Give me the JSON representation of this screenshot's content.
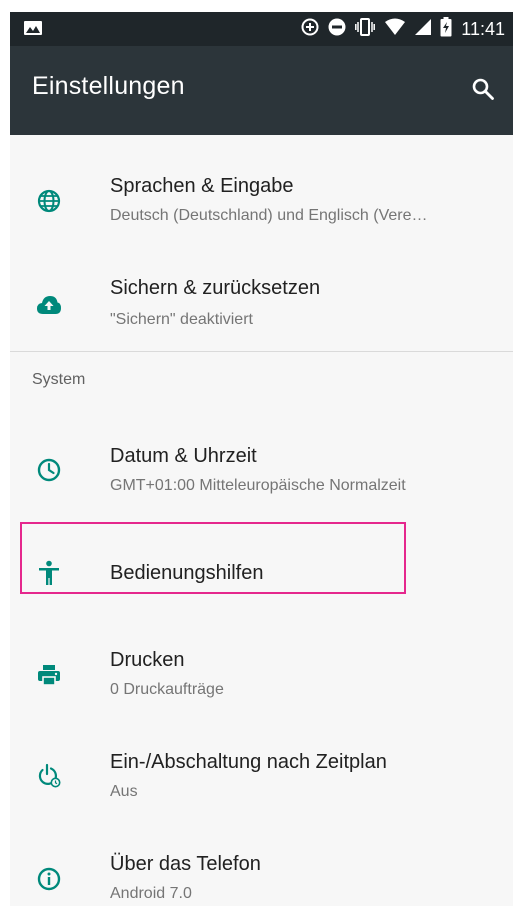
{
  "status_bar": {
    "time": "11:41",
    "icons": [
      "image-icon",
      "data-saver-icon",
      "do-not-disturb-icon",
      "vibrate-icon",
      "wifi-icon",
      "signal-icon",
      "battery-icon"
    ]
  },
  "app_bar": {
    "title": "Einstellungen",
    "search_icon": "search-icon"
  },
  "settings": {
    "items": [
      {
        "title": "Sprachen & Eingabe",
        "subtitle": "Deutsch (Deutschland) und Englisch (Vere…",
        "icon": "globe-icon"
      },
      {
        "title": "Sichern & zurücksetzen",
        "subtitle": "\"Sichern\" deaktiviert",
        "icon": "cloud-upload-icon"
      }
    ],
    "section_header": "System",
    "system_items": [
      {
        "title": "Datum & Uhrzeit",
        "subtitle": "GMT+01:00 Mitteleuropäische Normalzeit",
        "icon": "clock-icon"
      },
      {
        "title": "Bedienungshilfen",
        "subtitle": "",
        "icon": "accessibility-icon"
      },
      {
        "title": "Drucken",
        "subtitle": "0 Druckaufträge",
        "icon": "printer-icon"
      },
      {
        "title": "Ein-/Abschaltung nach Zeitplan",
        "subtitle": "Aus",
        "icon": "power-schedule-icon"
      },
      {
        "title": "Über das Telefon",
        "subtitle": "Android 7.0",
        "icon": "info-icon"
      }
    ]
  },
  "colors": {
    "status_bar": "#1f262a",
    "app_bar": "#2c353a",
    "accent": "#00897b",
    "highlight": "#e5278d"
  }
}
